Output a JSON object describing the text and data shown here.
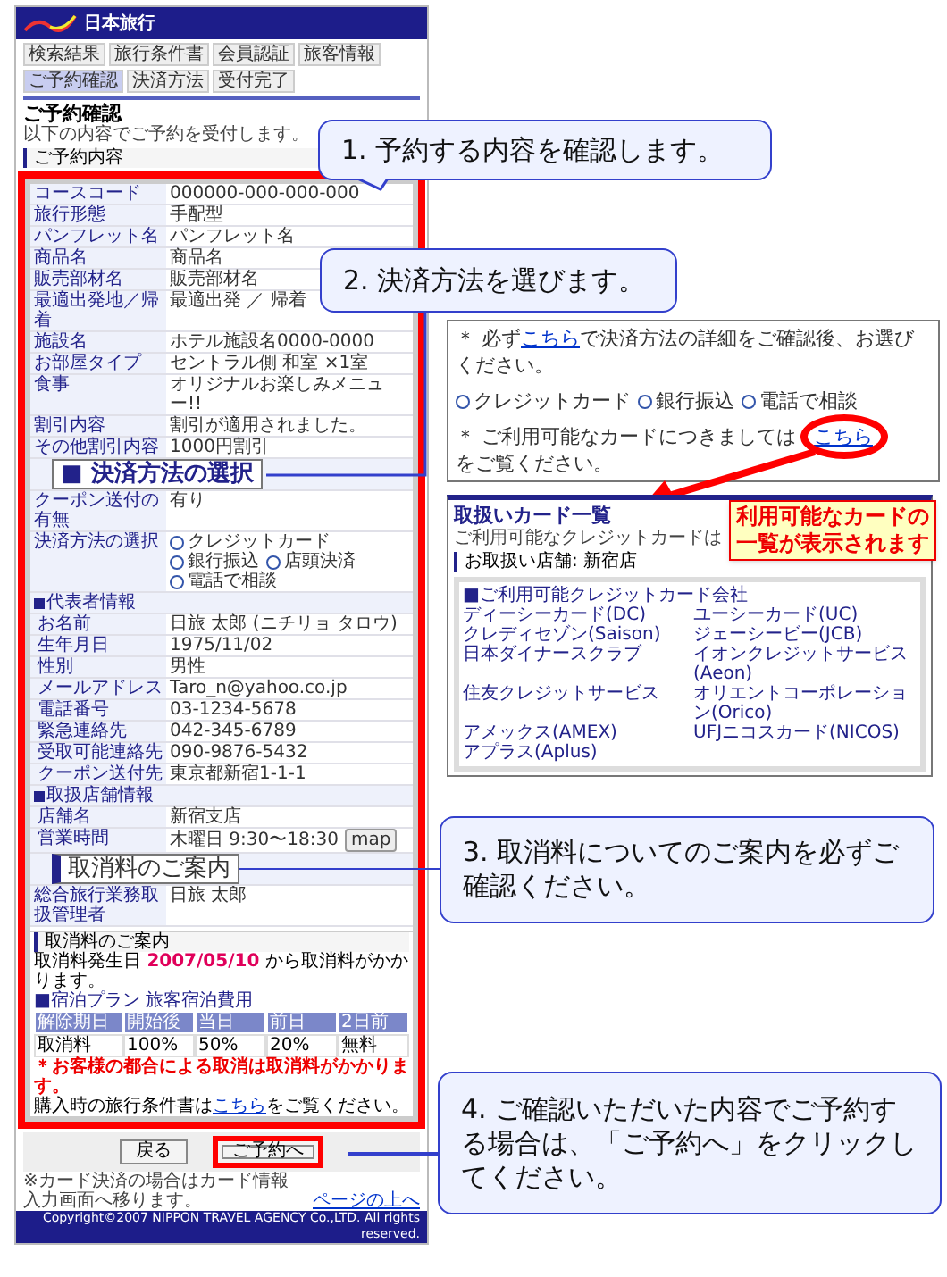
{
  "header": {
    "logo": "日本旅行"
  },
  "steps": [
    {
      "label": "検索結果",
      "selected": false
    },
    {
      "label": "旅行条件書",
      "selected": false
    },
    {
      "label": "会員認証",
      "selected": false
    },
    {
      "label": "旅客情報",
      "selected": false
    },
    {
      "label": "ご予約確認",
      "selected": true
    },
    {
      "label": "決済方法",
      "selected": false
    },
    {
      "label": "受付完了",
      "selected": false
    }
  ],
  "title": "ご予約確認",
  "intro": "以下の内容でご予約を受付します。",
  "section": "ご予約内容",
  "rows": [
    {
      "kind": "field",
      "label": "コースコード",
      "lines": [
        "000000-000-000-000"
      ]
    },
    {
      "kind": "field",
      "label": "旅行形態",
      "lines": [
        "手配型"
      ]
    },
    {
      "kind": "field",
      "label": "パンフレット名",
      "lines": [
        "パンフレット名"
      ]
    },
    {
      "kind": "field",
      "label": "商品名",
      "lines": [
        "商品名"
      ]
    },
    {
      "kind": "field",
      "label": "販売部材名",
      "lines": [
        "販売部材名"
      ]
    },
    {
      "kind": "field",
      "label": "最適出発地／帰着",
      "lines": [
        "最適出発 ／ 帰着"
      ]
    },
    {
      "kind": "field",
      "label": "施設名",
      "lines": [
        "ホテル施設名0000-0000"
      ]
    },
    {
      "kind": "field",
      "label": "お部屋タイプ",
      "lines": [
        "セントラル側 和室 ×1室"
      ]
    },
    {
      "kind": "field",
      "label": "食事",
      "lines": [
        "オリジナルお楽しみメニュー!!"
      ]
    },
    {
      "kind": "field",
      "label": "割引内容",
      "lines": [
        "割引が適用されました。"
      ]
    },
    {
      "kind": "field",
      "label": "その他割引内容",
      "lines": [
        "1000円割引"
      ]
    },
    {
      "kind": "covered"
    },
    {
      "kind": "field",
      "label": "クーポン送付の有無",
      "lines": [
        "有り"
      ]
    },
    {
      "kind": "payment",
      "label": "決済方法の選択",
      "options": [
        {
          "label": "クレジットカード",
          "selected": false
        },
        {
          "label": "銀行振込",
          "selected": false
        },
        {
          "label": "店頭決済",
          "selected": false
        },
        {
          "label": "電話で相談",
          "selected": false
        }
      ]
    },
    {
      "kind": "group",
      "label": "代表者情報"
    },
    {
      "kind": "sub",
      "label": "お名前",
      "lines": [
        "日旅 太郎 (ニチリョ タロウ)"
      ]
    },
    {
      "kind": "sub",
      "label": "生年月日",
      "lines": [
        "1975/11/02"
      ]
    },
    {
      "kind": "sub",
      "label": "性別",
      "lines": [
        "男性"
      ]
    },
    {
      "kind": "sub",
      "label": "メールアドレス",
      "lines": [
        "Taro_n@yahoo.co.jp"
      ]
    },
    {
      "kind": "sub",
      "label": "電話番号",
      "lines": [
        "03-1234-5678"
      ]
    },
    {
      "kind": "sub",
      "label": "緊急連絡先",
      "lines": [
        "042-345-6789"
      ]
    },
    {
      "kind": "sub",
      "label": "受取可能連絡先",
      "lines": [
        "090-9876-5432"
      ]
    },
    {
      "kind": "sub",
      "label": "クーポン送付先",
      "lines": [
        "東京都新宿1-1-1"
      ]
    },
    {
      "kind": "group",
      "label": "取扱店舗情報"
    },
    {
      "kind": "sub",
      "label": "店舗名",
      "lines": [
        "新宿支店"
      ]
    },
    {
      "kind": "sub",
      "label": "営業時間",
      "lines": [
        "木曜日 9:30〜18:30"
      ],
      "map": "map"
    },
    {
      "kind": "covered"
    },
    {
      "kind": "field",
      "label": "総合旅行業務取扱管理者",
      "lines": [
        "日旅 太郎"
      ]
    }
  ],
  "cancel": {
    "title": "取消料のご案内",
    "date_before": "取消料発生日 ",
    "date": "2007/05/10",
    "date_after": " から取消料がかかります。",
    "plan": "■宿泊プラン 旅客宿泊費用",
    "columns": [
      "解除期日",
      "開始後",
      "当日",
      "前日",
      "2日前"
    ],
    "row": [
      "取消料",
      "100%",
      "50%",
      "20%",
      "無料"
    ],
    "warning": "＊お客様の都合による取消は取消料がかかります。",
    "link_before": "購入時の旅行条件書は",
    "link": "こちら",
    "link_after": "をご覧ください。"
  },
  "buttons": [
    {
      "label": "戻る",
      "highlighted": false
    },
    {
      "label": "ご予約へ",
      "highlighted": true
    }
  ],
  "footer_note": "※カード決済の場合はカード情報入力画面へ移ります。",
  "page_top": "ページの上へ",
  "copyright": "Copyright©2007 NIPPON TRAVEL AGENCY Co.,LTD. All rights reserved.",
  "payment_panel": {
    "before": "＊ 必ず",
    "link": "こちら",
    "after": "で決済方法の詳細をご確認後、お選びください。",
    "options": [
      {
        "label": "クレジットカード",
        "selected": false
      },
      {
        "label": "銀行振込",
        "selected": false
      },
      {
        "label": "電話で相談",
        "selected": false
      }
    ],
    "before2": "＊ ご利用可能なカードにつきましては",
    "link2": "こちら",
    "after2": "をご覧ください。"
  },
  "card_panel": {
    "title": "取扱いカード一覧",
    "intro": "ご利用可能なクレジットカードは",
    "store": "お取扱い店舗: 新宿店",
    "heading": "■ご利用可能クレジットカード会社",
    "cards": [
      "ディーシーカード(DC)",
      "ユーシーカード(UC)",
      "クレディセゾン(Saison)",
      "ジェーシービー(JCB)",
      "日本ダイナースクラブ",
      "イオンクレジットサービス(Aeon)",
      "住友クレジットサービス",
      "オリエントコーポレーション(Orico)",
      "アメックス(AMEX)",
      "UFJニコスカード(NICOS)",
      "アプラス(Aplus)"
    ]
  },
  "tip": "利用可能なカードの一覧が表示されます",
  "callouts": [
    "1. 予約する内容を確認します。",
    "2. 決済方法を選びます。",
    "3. 取消料についてのご案内を必ずご確認ください。",
    "4. ご確認いただいた内容でご予約する場合は、「ご予約へ」をクリックしてください。"
  ],
  "labels": [
    "■ 決済方法の選択",
    "取消料のご案内"
  ]
}
